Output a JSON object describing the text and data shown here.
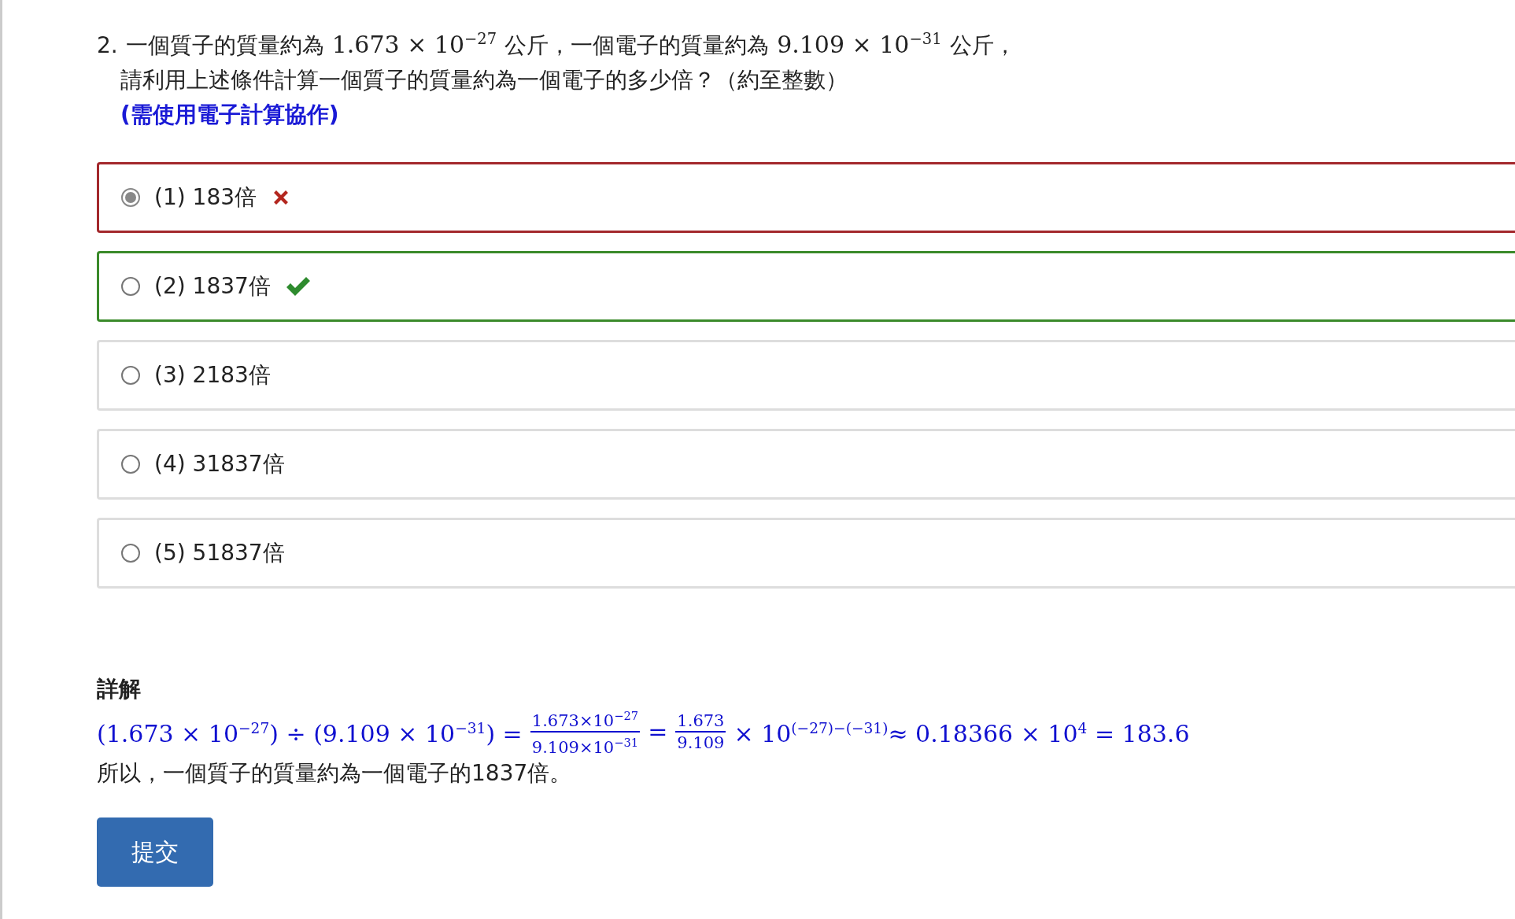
{
  "question": {
    "number": "2.",
    "line1": [
      {
        "kind": "text",
        "text": "一個質子的質量約為"
      },
      {
        "kind": "math",
        "text": "1.673 × 10$^{−27}$"
      },
      {
        "kind": "text",
        "text": "公斤，一個電子的質量約為"
      },
      {
        "kind": "math",
        "text": "9.109 × 10$^{−31}$"
      },
      {
        "kind": "text",
        "text": "公斤，"
      }
    ],
    "line2": "請利用上述條件計算一個質子的質量約為一個電子的多少倍？（約至整數）",
    "hint": "(需使用電子計算協作)"
  },
  "options": [
    {
      "label": "(1) 183倍",
      "selected": true,
      "kind": "incorrect"
    },
    {
      "label": "(2) 1837倍",
      "selected": false,
      "kind": "correct"
    },
    {
      "label": "(3) 2183倍",
      "selected": false,
      "kind": "plain"
    },
    {
      "label": "(4) 31837倍",
      "selected": false,
      "kind": "plain"
    },
    {
      "label": "(5) 51837倍",
      "selected": false,
      "kind": "plain"
    }
  ],
  "solution": {
    "heading": "詳解",
    "formula": [
      {
        "kind": "math",
        "text": "(1.673 × 10$^{−27}$) ÷ (9.109 × 10$^{−31}$) ="
      },
      {
        "kind": "frac",
        "num": "1.673×10$^{−27}$",
        "den": "9.109×10$^{−31}$"
      },
      {
        "kind": "math",
        "text": "="
      },
      {
        "kind": "frac",
        "num": "1.673",
        "den": "9.109"
      },
      {
        "kind": "math",
        "text": "× 10$^{(−27)−(−31)}$≈ 0.18366 × 10$^{4}$ = 183.6"
      }
    ],
    "conclusion": "所以，一個質子的質量約為一個電子的1837倍。"
  },
  "submit_button": "提交"
}
